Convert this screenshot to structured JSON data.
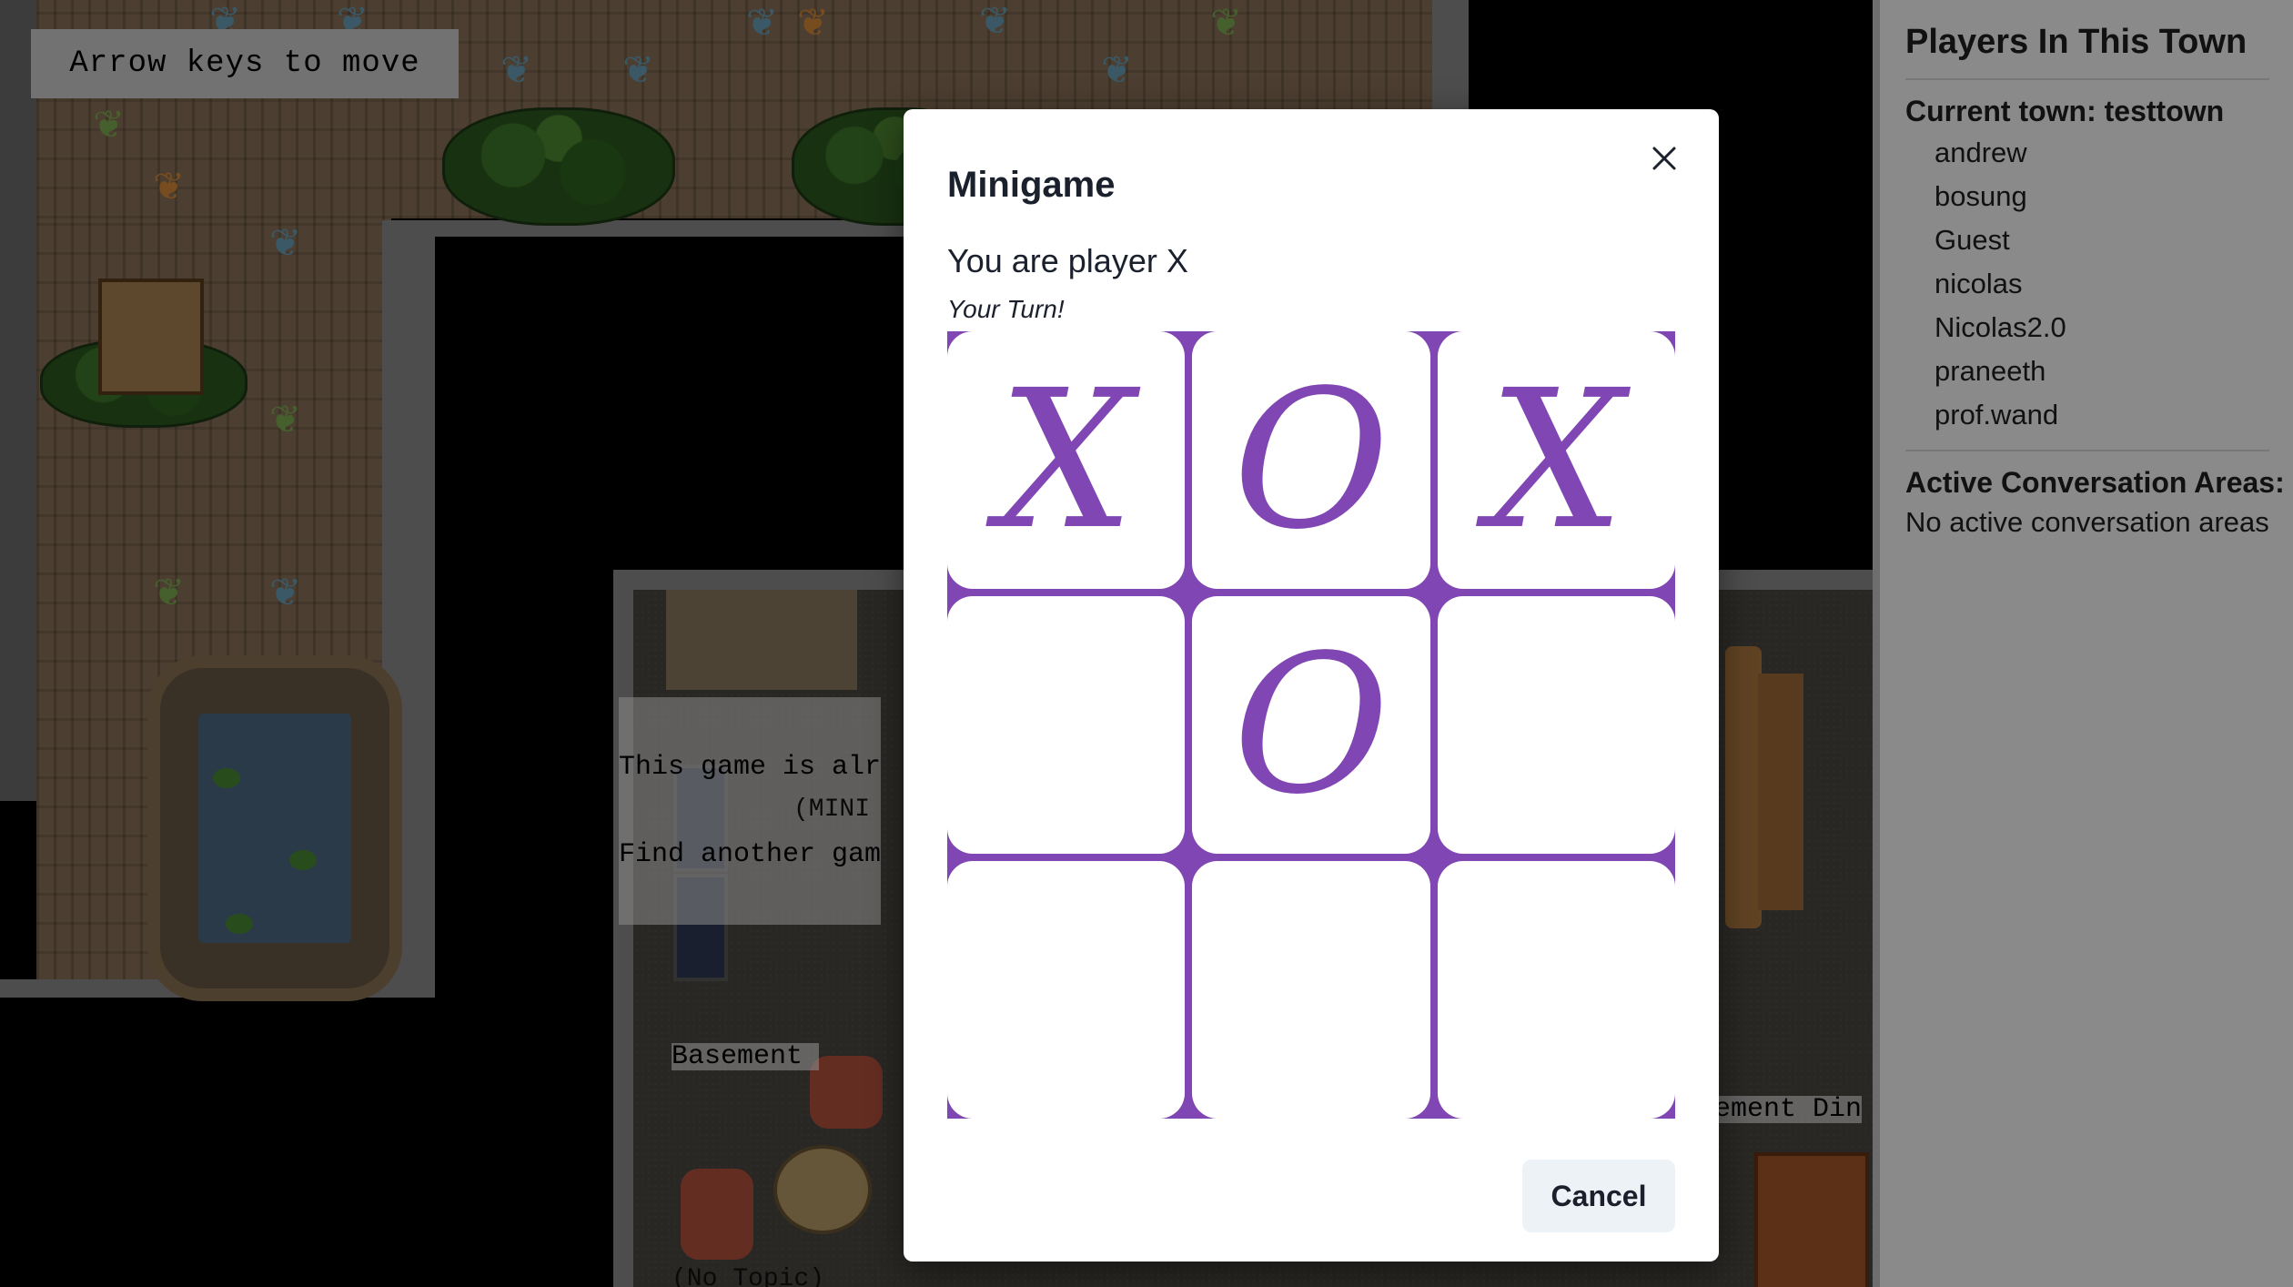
{
  "game": {
    "instructions": "Arrow keys to move",
    "overlay_text_line1": "This game is alr",
    "overlay_text_line2": "Find another gam",
    "minigame_label": "(MINI",
    "basement_lounge_label": "Basement ",
    "basement_dining_label": "ement Din",
    "no_topic_label": "(No Topic)"
  },
  "sidebar": {
    "title": "Players In This Town",
    "current_town_label": "Current town: testtown",
    "players": [
      "andrew",
      "bosung",
      "Guest",
      "nicolas",
      "Nicolas2.0",
      "praneeth",
      "prof.wand"
    ],
    "active_areas_title": "Active Conversation Areas:",
    "active_areas_empty": "No active conversation areas"
  },
  "modal": {
    "title": "Minigame",
    "close_icon": "close-icon",
    "player_text": "You are player X",
    "turn_text": "Your Turn!",
    "board": [
      [
        "X",
        "O",
        "X"
      ],
      [
        "",
        "O",
        ""
      ],
      [
        "",
        "",
        ""
      ]
    ],
    "cancel_label": "Cancel"
  },
  "colors": {
    "accent": "#8046b3",
    "modal_bg": "#ffffff",
    "cancel_bg": "#edf2f7",
    "sidebar_bg": "#8a8a8a"
  }
}
